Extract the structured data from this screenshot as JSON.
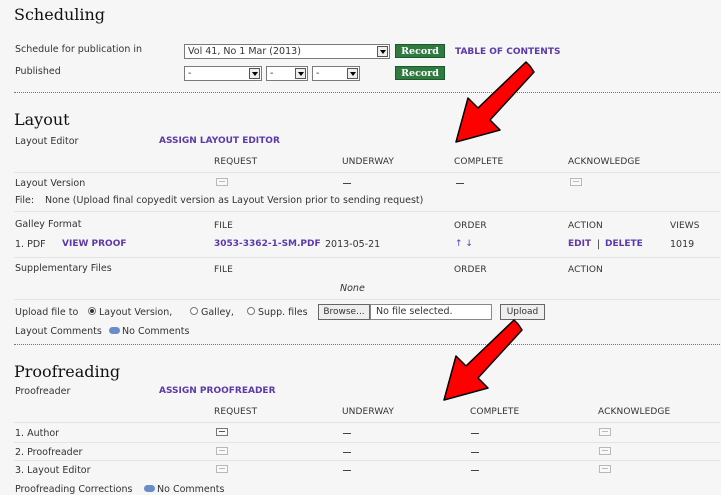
{
  "scheduling": {
    "title": "Scheduling",
    "schedule_label": "Schedule for publication in",
    "issue_selected": "Vol 41, No 1 Mar (2013)",
    "record_label": "Record",
    "toc_link": "TABLE OF CONTENTS",
    "published_label": "Published",
    "date_selects": [
      "-",
      "-",
      "-"
    ]
  },
  "layout": {
    "title": "Layout",
    "editor_label": "Layout Editor",
    "assign_link": "ASSIGN LAYOUT EDITOR",
    "status_headers": [
      "REQUEST",
      "UNDERWAY",
      "COMPLETE",
      "ACKNOWLEDGE"
    ],
    "version_label": "Layout Version",
    "file_label": "File:",
    "file_value": "None (Upload final copyedit version as Layout Version prior to sending request)",
    "galley_headers": [
      "Galley Format",
      "FILE",
      "ORDER",
      "ACTION",
      "VIEWS"
    ],
    "galley_row": {
      "index": "1. PDF",
      "view_proof": "VIEW PROOF",
      "file_name": "3053-3362-1-SM.PDF",
      "date": "2013-05-21",
      "order": "↑ ↓",
      "edit": "EDIT",
      "sep": "|",
      "delete": "DELETE",
      "views": "1019"
    },
    "supp_headers": [
      "Supplementary Files",
      "FILE",
      "ORDER",
      "ACTION"
    ],
    "supp_none": "None",
    "upload_label": "Upload file to",
    "upload_options": [
      "Layout Version,",
      "Galley,",
      "Supp. files"
    ],
    "browse_label": "Browse...",
    "no_file": "No file selected.",
    "upload_button": "Upload",
    "comments_label": "Layout Comments",
    "comments_value": "No Comments"
  },
  "proofreading": {
    "title": "Proofreading",
    "proofreader_label": "Proofreader",
    "assign_link": "ASSIGN PROOFREADER",
    "status_headers": [
      "REQUEST",
      "UNDERWAY",
      "COMPLETE",
      "ACKNOWLEDGE"
    ],
    "rows": [
      "1. Author",
      "2. Proofreader",
      "3. Layout Editor"
    ],
    "corrections_label": "Proofreading Corrections",
    "corrections_value": "No Comments"
  },
  "colors": {
    "link": "#5b3aa8",
    "record_button": "#2f7a3f",
    "annotation_arrow": "#ff0000"
  }
}
